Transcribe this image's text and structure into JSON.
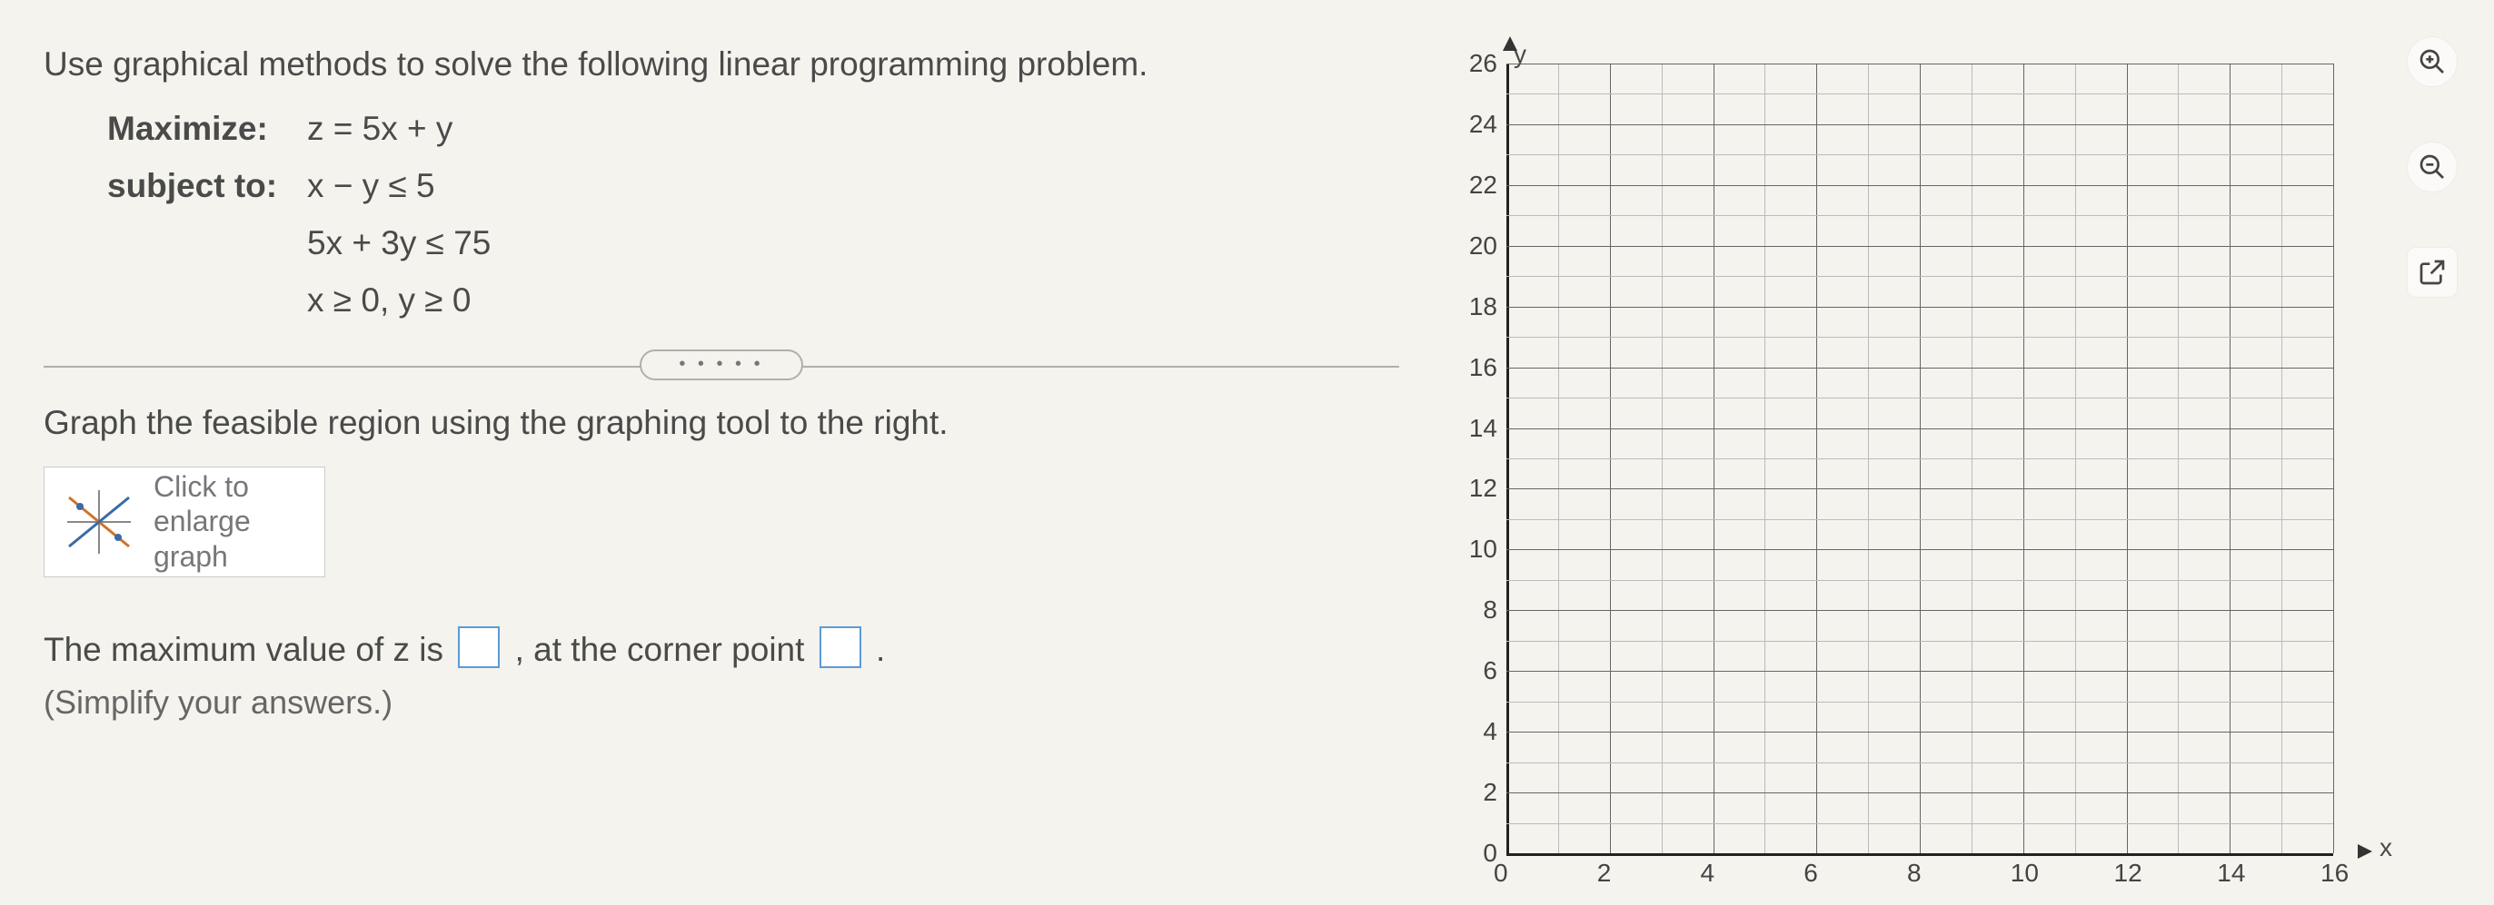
{
  "problem": {
    "prompt": "Use graphical methods to solve the following linear programming problem.",
    "maximize_label": "Maximize:",
    "maximize_expr": "z = 5x + y",
    "subject_label": "subject to:",
    "c1": "x − y ≤ 5",
    "c2": "5x + 3y ≤ 75",
    "c3": "x ≥ 0, y ≥ 0"
  },
  "divider_dots": "• • • • •",
  "instruction": "Graph the feasible region using the graphing tool to the right.",
  "enlarge": {
    "l1": "Click to",
    "l2": "enlarge",
    "l3": "graph"
  },
  "answer": {
    "part1": "The maximum value of z is ",
    "part2": ", at the corner point ",
    "part3": ".",
    "hint": "(Simplify your answers.)"
  },
  "icons": {
    "zoom_in": "zoom-in",
    "zoom_out": "zoom-out",
    "popout": "open-in-new"
  },
  "chart_data": {
    "type": "scatter",
    "title": "",
    "xlabel": "x",
    "ylabel": "y",
    "xlim": [
      0,
      16
    ],
    "ylim": [
      0,
      26
    ],
    "x_ticks": [
      0,
      2,
      4,
      6,
      8,
      10,
      12,
      14,
      16
    ],
    "y_ticks": [
      0,
      2,
      4,
      6,
      8,
      10,
      12,
      14,
      16,
      18,
      20,
      22,
      24,
      26
    ],
    "x_minor_step": 1,
    "y_minor_step": 1,
    "series": []
  }
}
